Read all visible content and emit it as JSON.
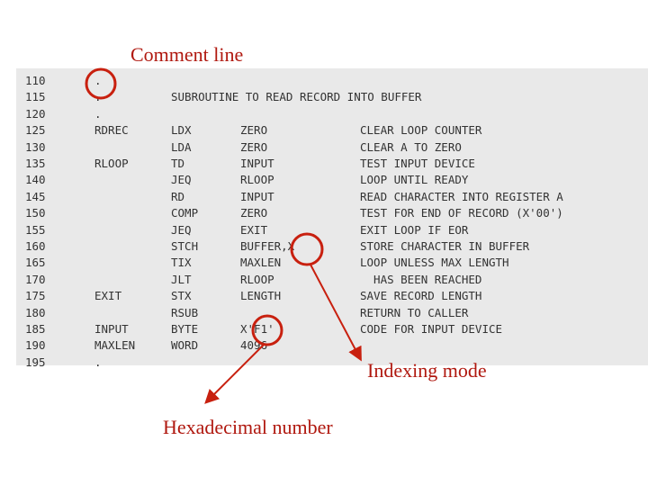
{
  "annotations": {
    "comment_line": "Comment line",
    "indexing_mode": "Indexing mode",
    "hex_number": "Hexadecimal number",
    "color": "#c8200f"
  },
  "code": [
    {
      "line": "110",
      "label": ".",
      "op": "",
      "operand": "",
      "comment": ""
    },
    {
      "line": "115",
      "label": ".",
      "op": "SUBROUTINE TO READ RECORD INTO BUFFER",
      "operand": "",
      "comment": ""
    },
    {
      "line": "120",
      "label": ".",
      "op": "",
      "operand": "",
      "comment": ""
    },
    {
      "line": "125",
      "label": "RDREC",
      "op": "LDX",
      "operand": "ZERO",
      "comment": "CLEAR LOOP COUNTER"
    },
    {
      "line": "130",
      "label": "",
      "op": "LDA",
      "operand": "ZERO",
      "comment": "CLEAR A TO ZERO"
    },
    {
      "line": "135",
      "label": "RLOOP",
      "op": "TD",
      "operand": "INPUT",
      "comment": "TEST INPUT DEVICE"
    },
    {
      "line": "140",
      "label": "",
      "op": "JEQ",
      "operand": "RLOOP",
      "comment": "LOOP UNTIL READY"
    },
    {
      "line": "145",
      "label": "",
      "op": "RD",
      "operand": "INPUT",
      "comment": "READ CHARACTER INTO REGISTER A"
    },
    {
      "line": "150",
      "label": "",
      "op": "COMP",
      "operand": "ZERO",
      "comment": "TEST FOR END OF RECORD (X'00')"
    },
    {
      "line": "155",
      "label": "",
      "op": "JEQ",
      "operand": "EXIT",
      "comment": "EXIT LOOP IF EOR"
    },
    {
      "line": "160",
      "label": "",
      "op": "STCH",
      "operand": "BUFFER,X",
      "comment": "STORE CHARACTER IN BUFFER"
    },
    {
      "line": "165",
      "label": "",
      "op": "TIX",
      "operand": "MAXLEN",
      "comment": "LOOP UNLESS MAX LENGTH"
    },
    {
      "line": "170",
      "label": "",
      "op": "JLT",
      "operand": "RLOOP",
      "comment": "  HAS BEEN REACHED"
    },
    {
      "line": "175",
      "label": "EXIT",
      "op": "STX",
      "operand": "LENGTH",
      "comment": "SAVE RECORD LENGTH"
    },
    {
      "line": "180",
      "label": "",
      "op": "RSUB",
      "operand": "",
      "comment": "RETURN TO CALLER"
    },
    {
      "line": "185",
      "label": "INPUT",
      "op": "BYTE",
      "operand": "X'F1'",
      "comment": "CODE FOR INPUT DEVICE"
    },
    {
      "line": "190",
      "label": "MAXLEN",
      "op": "WORD",
      "operand": "4096",
      "comment": ""
    },
    {
      "line": "195",
      "label": ".",
      "op": "",
      "operand": "",
      "comment": ""
    }
  ]
}
